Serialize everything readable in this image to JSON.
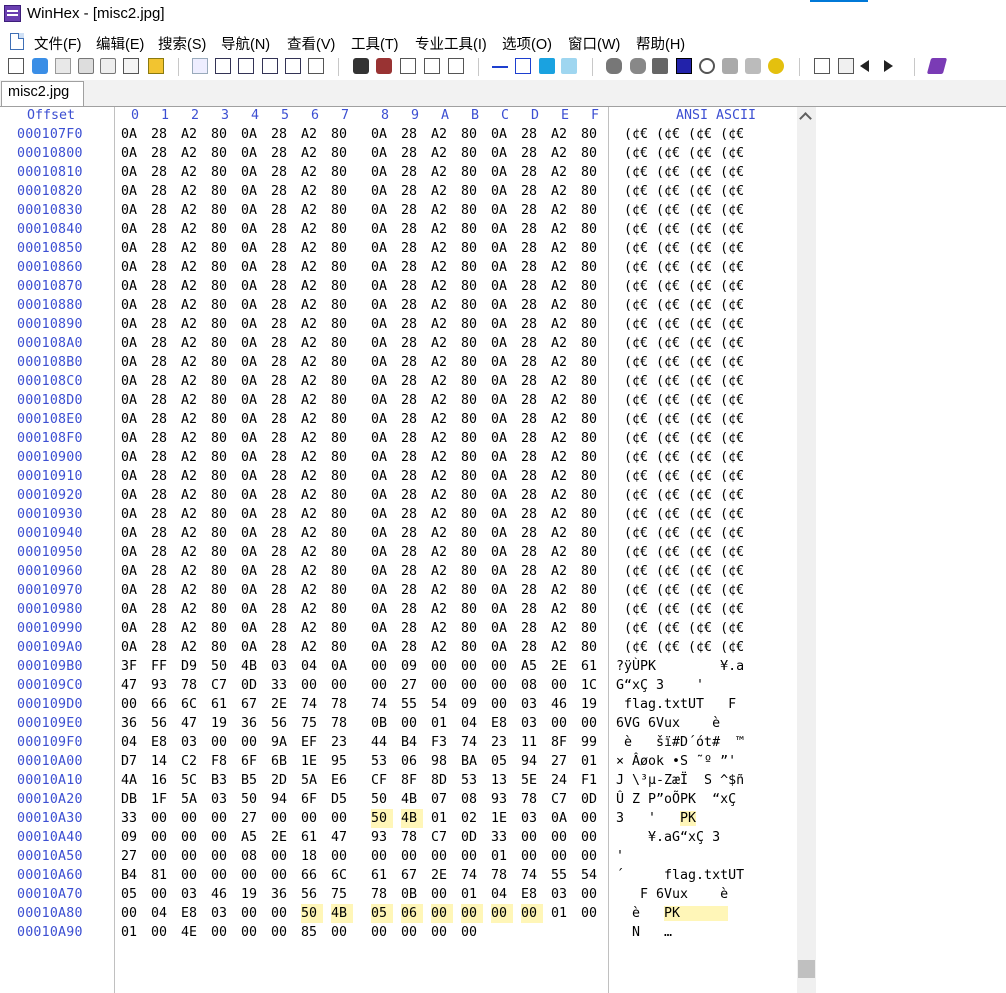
{
  "window": {
    "title": "WinHex - [misc2.jpg]"
  },
  "menu": [
    "文件(F)",
    "编辑(E)",
    "搜索(S)",
    "导航(N)",
    "查看(V)",
    "工具(T)",
    "专业工具(I)",
    "选项(O)",
    "窗口(W)",
    "帮助(H)"
  ],
  "tab": {
    "label": "misc2.jpg"
  },
  "header": {
    "offset": "Offset",
    "columns": [
      "0",
      "1",
      "2",
      "3",
      "4",
      "5",
      "6",
      "7",
      "8",
      "9",
      "A",
      "B",
      "C",
      "D",
      "E",
      "F"
    ],
    "ansi": "ANSI ASCII"
  },
  "rows": [
    {
      "offset": "000107F0",
      "hex": [
        "0A",
        "28",
        "A2",
        "80",
        "0A",
        "28",
        "A2",
        "80",
        "0A",
        "28",
        "A2",
        "80",
        "0A",
        "28",
        "A2",
        "80"
      ],
      "ascii": " (¢€ (¢€ (¢€ (¢€"
    },
    {
      "offset": "00010800",
      "hex": [
        "0A",
        "28",
        "A2",
        "80",
        "0A",
        "28",
        "A2",
        "80",
        "0A",
        "28",
        "A2",
        "80",
        "0A",
        "28",
        "A2",
        "80"
      ],
      "ascii": " (¢€ (¢€ (¢€ (¢€"
    },
    {
      "offset": "00010810",
      "hex": [
        "0A",
        "28",
        "A2",
        "80",
        "0A",
        "28",
        "A2",
        "80",
        "0A",
        "28",
        "A2",
        "80",
        "0A",
        "28",
        "A2",
        "80"
      ],
      "ascii": " (¢€ (¢€ (¢€ (¢€"
    },
    {
      "offset": "00010820",
      "hex": [
        "0A",
        "28",
        "A2",
        "80",
        "0A",
        "28",
        "A2",
        "80",
        "0A",
        "28",
        "A2",
        "80",
        "0A",
        "28",
        "A2",
        "80"
      ],
      "ascii": " (¢€ (¢€ (¢€ (¢€"
    },
    {
      "offset": "00010830",
      "hex": [
        "0A",
        "28",
        "A2",
        "80",
        "0A",
        "28",
        "A2",
        "80",
        "0A",
        "28",
        "A2",
        "80",
        "0A",
        "28",
        "A2",
        "80"
      ],
      "ascii": " (¢€ (¢€ (¢€ (¢€"
    },
    {
      "offset": "00010840",
      "hex": [
        "0A",
        "28",
        "A2",
        "80",
        "0A",
        "28",
        "A2",
        "80",
        "0A",
        "28",
        "A2",
        "80",
        "0A",
        "28",
        "A2",
        "80"
      ],
      "ascii": " (¢€ (¢€ (¢€ (¢€"
    },
    {
      "offset": "00010850",
      "hex": [
        "0A",
        "28",
        "A2",
        "80",
        "0A",
        "28",
        "A2",
        "80",
        "0A",
        "28",
        "A2",
        "80",
        "0A",
        "28",
        "A2",
        "80"
      ],
      "ascii": " (¢€ (¢€ (¢€ (¢€"
    },
    {
      "offset": "00010860",
      "hex": [
        "0A",
        "28",
        "A2",
        "80",
        "0A",
        "28",
        "A2",
        "80",
        "0A",
        "28",
        "A2",
        "80",
        "0A",
        "28",
        "A2",
        "80"
      ],
      "ascii": " (¢€ (¢€ (¢€ (¢€"
    },
    {
      "offset": "00010870",
      "hex": [
        "0A",
        "28",
        "A2",
        "80",
        "0A",
        "28",
        "A2",
        "80",
        "0A",
        "28",
        "A2",
        "80",
        "0A",
        "28",
        "A2",
        "80"
      ],
      "ascii": " (¢€ (¢€ (¢€ (¢€"
    },
    {
      "offset": "00010880",
      "hex": [
        "0A",
        "28",
        "A2",
        "80",
        "0A",
        "28",
        "A2",
        "80",
        "0A",
        "28",
        "A2",
        "80",
        "0A",
        "28",
        "A2",
        "80"
      ],
      "ascii": " (¢€ (¢€ (¢€ (¢€"
    },
    {
      "offset": "00010890",
      "hex": [
        "0A",
        "28",
        "A2",
        "80",
        "0A",
        "28",
        "A2",
        "80",
        "0A",
        "28",
        "A2",
        "80",
        "0A",
        "28",
        "A2",
        "80"
      ],
      "ascii": " (¢€ (¢€ (¢€ (¢€"
    },
    {
      "offset": "000108A0",
      "hex": [
        "0A",
        "28",
        "A2",
        "80",
        "0A",
        "28",
        "A2",
        "80",
        "0A",
        "28",
        "A2",
        "80",
        "0A",
        "28",
        "A2",
        "80"
      ],
      "ascii": " (¢€ (¢€ (¢€ (¢€"
    },
    {
      "offset": "000108B0",
      "hex": [
        "0A",
        "28",
        "A2",
        "80",
        "0A",
        "28",
        "A2",
        "80",
        "0A",
        "28",
        "A2",
        "80",
        "0A",
        "28",
        "A2",
        "80"
      ],
      "ascii": " (¢€ (¢€ (¢€ (¢€"
    },
    {
      "offset": "000108C0",
      "hex": [
        "0A",
        "28",
        "A2",
        "80",
        "0A",
        "28",
        "A2",
        "80",
        "0A",
        "28",
        "A2",
        "80",
        "0A",
        "28",
        "A2",
        "80"
      ],
      "ascii": " (¢€ (¢€ (¢€ (¢€"
    },
    {
      "offset": "000108D0",
      "hex": [
        "0A",
        "28",
        "A2",
        "80",
        "0A",
        "28",
        "A2",
        "80",
        "0A",
        "28",
        "A2",
        "80",
        "0A",
        "28",
        "A2",
        "80"
      ],
      "ascii": " (¢€ (¢€ (¢€ (¢€"
    },
    {
      "offset": "000108E0",
      "hex": [
        "0A",
        "28",
        "A2",
        "80",
        "0A",
        "28",
        "A2",
        "80",
        "0A",
        "28",
        "A2",
        "80",
        "0A",
        "28",
        "A2",
        "80"
      ],
      "ascii": " (¢€ (¢€ (¢€ (¢€"
    },
    {
      "offset": "000108F0",
      "hex": [
        "0A",
        "28",
        "A2",
        "80",
        "0A",
        "28",
        "A2",
        "80",
        "0A",
        "28",
        "A2",
        "80",
        "0A",
        "28",
        "A2",
        "80"
      ],
      "ascii": " (¢€ (¢€ (¢€ (¢€"
    },
    {
      "offset": "00010900",
      "hex": [
        "0A",
        "28",
        "A2",
        "80",
        "0A",
        "28",
        "A2",
        "80",
        "0A",
        "28",
        "A2",
        "80",
        "0A",
        "28",
        "A2",
        "80"
      ],
      "ascii": " (¢€ (¢€ (¢€ (¢€"
    },
    {
      "offset": "00010910",
      "hex": [
        "0A",
        "28",
        "A2",
        "80",
        "0A",
        "28",
        "A2",
        "80",
        "0A",
        "28",
        "A2",
        "80",
        "0A",
        "28",
        "A2",
        "80"
      ],
      "ascii": " (¢€ (¢€ (¢€ (¢€"
    },
    {
      "offset": "00010920",
      "hex": [
        "0A",
        "28",
        "A2",
        "80",
        "0A",
        "28",
        "A2",
        "80",
        "0A",
        "28",
        "A2",
        "80",
        "0A",
        "28",
        "A2",
        "80"
      ],
      "ascii": " (¢€ (¢€ (¢€ (¢€"
    },
    {
      "offset": "00010930",
      "hex": [
        "0A",
        "28",
        "A2",
        "80",
        "0A",
        "28",
        "A2",
        "80",
        "0A",
        "28",
        "A2",
        "80",
        "0A",
        "28",
        "A2",
        "80"
      ],
      "ascii": " (¢€ (¢€ (¢€ (¢€"
    },
    {
      "offset": "00010940",
      "hex": [
        "0A",
        "28",
        "A2",
        "80",
        "0A",
        "28",
        "A2",
        "80",
        "0A",
        "28",
        "A2",
        "80",
        "0A",
        "28",
        "A2",
        "80"
      ],
      "ascii": " (¢€ (¢€ (¢€ (¢€"
    },
    {
      "offset": "00010950",
      "hex": [
        "0A",
        "28",
        "A2",
        "80",
        "0A",
        "28",
        "A2",
        "80",
        "0A",
        "28",
        "A2",
        "80",
        "0A",
        "28",
        "A2",
        "80"
      ],
      "ascii": " (¢€ (¢€ (¢€ (¢€"
    },
    {
      "offset": "00010960",
      "hex": [
        "0A",
        "28",
        "A2",
        "80",
        "0A",
        "28",
        "A2",
        "80",
        "0A",
        "28",
        "A2",
        "80",
        "0A",
        "28",
        "A2",
        "80"
      ],
      "ascii": " (¢€ (¢€ (¢€ (¢€"
    },
    {
      "offset": "00010970",
      "hex": [
        "0A",
        "28",
        "A2",
        "80",
        "0A",
        "28",
        "A2",
        "80",
        "0A",
        "28",
        "A2",
        "80",
        "0A",
        "28",
        "A2",
        "80"
      ],
      "ascii": " (¢€ (¢€ (¢€ (¢€"
    },
    {
      "offset": "00010980",
      "hex": [
        "0A",
        "28",
        "A2",
        "80",
        "0A",
        "28",
        "A2",
        "80",
        "0A",
        "28",
        "A2",
        "80",
        "0A",
        "28",
        "A2",
        "80"
      ],
      "ascii": " (¢€ (¢€ (¢€ (¢€"
    },
    {
      "offset": "00010990",
      "hex": [
        "0A",
        "28",
        "A2",
        "80",
        "0A",
        "28",
        "A2",
        "80",
        "0A",
        "28",
        "A2",
        "80",
        "0A",
        "28",
        "A2",
        "80"
      ],
      "ascii": " (¢€ (¢€ (¢€ (¢€"
    },
    {
      "offset": "000109A0",
      "hex": [
        "0A",
        "28",
        "A2",
        "80",
        "0A",
        "28",
        "A2",
        "80",
        "0A",
        "28",
        "A2",
        "80",
        "0A",
        "28",
        "A2",
        "80"
      ],
      "ascii": " (¢€ (¢€ (¢€ (¢€"
    },
    {
      "offset": "000109B0",
      "hex": [
        "3F",
        "FF",
        "D9",
        "50",
        "4B",
        "03",
        "04",
        "0A",
        "00",
        "09",
        "00",
        "00",
        "00",
        "A5",
        "2E",
        "61"
      ],
      "ascii": "?ÿÙPK        ¥.a"
    },
    {
      "offset": "000109C0",
      "hex": [
        "47",
        "93",
        "78",
        "C7",
        "0D",
        "33",
        "00",
        "00",
        "00",
        "27",
        "00",
        "00",
        "00",
        "08",
        "00",
        "1C"
      ],
      "ascii": "G“xÇ 3    '     "
    },
    {
      "offset": "000109D0",
      "hex": [
        "00",
        "66",
        "6C",
        "61",
        "67",
        "2E",
        "74",
        "78",
        "74",
        "55",
        "54",
        "09",
        "00",
        "03",
        "46",
        "19"
      ],
      "ascii": " flag.txtUT   F "
    },
    {
      "offset": "000109E0",
      "hex": [
        "36",
        "56",
        "47",
        "19",
        "36",
        "56",
        "75",
        "78",
        "0B",
        "00",
        "01",
        "04",
        "E8",
        "03",
        "00",
        "00"
      ],
      "ascii": "6VG 6Vux    è   "
    },
    {
      "offset": "000109F0",
      "hex": [
        "04",
        "E8",
        "03",
        "00",
        "00",
        "9A",
        "EF",
        "23",
        "44",
        "B4",
        "F3",
        "74",
        "23",
        "11",
        "8F",
        "99"
      ],
      "ascii": " è   šï#D´ót#  ™"
    },
    {
      "offset": "00010A00",
      "hex": [
        "D7",
        "14",
        "C2",
        "F8",
        "6F",
        "6B",
        "1E",
        "95",
        "53",
        "06",
        "98",
        "BA",
        "05",
        "94",
        "27",
        "01"
      ],
      "ascii": "× Âøok •S ˜º ”' "
    },
    {
      "offset": "00010A10",
      "hex": [
        "4A",
        "16",
        "5C",
        "B3",
        "B5",
        "2D",
        "5A",
        "E6",
        "CF",
        "8F",
        "8D",
        "53",
        "13",
        "5E",
        "24",
        "F1"
      ],
      "ascii": "J \\³µ-ZæÏ  S ^$ñ"
    },
    {
      "offset": "00010A20",
      "hex": [
        "DB",
        "1F",
        "5A",
        "03",
        "50",
        "94",
        "6F",
        "D5",
        "50",
        "4B",
        "07",
        "08",
        "93",
        "78",
        "C7",
        "0D"
      ],
      "ascii": "Û Z P”oÕPK  “xÇ "
    },
    {
      "offset": "00010A30",
      "hex": [
        "33",
        "00",
        "00",
        "00",
        "27",
        "00",
        "00",
        "00",
        "50",
        "4B",
        "01",
        "02",
        "1E",
        "03",
        "0A",
        "00"
      ],
      "ascii": "3   '   PK      "
    },
    {
      "offset": "00010A40",
      "hex": [
        "09",
        "00",
        "00",
        "00",
        "A5",
        "2E",
        "61",
        "47",
        "93",
        "78",
        "C7",
        "0D",
        "33",
        "00",
        "00",
        "00"
      ],
      "ascii": "    ¥.aG“xÇ 3   "
    },
    {
      "offset": "00010A50",
      "hex": [
        "27",
        "00",
        "00",
        "00",
        "08",
        "00",
        "18",
        "00",
        "00",
        "00",
        "00",
        "00",
        "01",
        "00",
        "00",
        "00"
      ],
      "ascii": "'               "
    },
    {
      "offset": "00010A60",
      "hex": [
        "B4",
        "81",
        "00",
        "00",
        "00",
        "00",
        "66",
        "6C",
        "61",
        "67",
        "2E",
        "74",
        "78",
        "74",
        "55",
        "54"
      ],
      "ascii": "´     flag.txtUT"
    },
    {
      "offset": "00010A70",
      "hex": [
        "05",
        "00",
        "03",
        "46",
        "19",
        "36",
        "56",
        "75",
        "78",
        "0B",
        "00",
        "01",
        "04",
        "E8",
        "03",
        "00"
      ],
      "ascii": "   F 6Vux    è  "
    },
    {
      "offset": "00010A80",
      "hex": [
        "00",
        "04",
        "E8",
        "03",
        "00",
        "00",
        "50",
        "4B",
        "05",
        "06",
        "00",
        "00",
        "00",
        "00",
        "01",
        "00"
      ],
      "ascii": "  è   PK        "
    },
    {
      "offset": "00010A90",
      "hex": [
        "01",
        "00",
        "4E",
        "00",
        "00",
        "00",
        "85",
        "00",
        "00",
        "00",
        "00",
        "00"
      ],
      "ascii": "  N   …     "
    }
  ]
}
